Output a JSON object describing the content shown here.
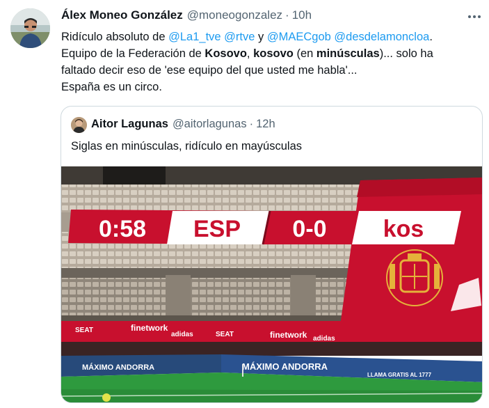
{
  "tweet": {
    "author_name": "Álex Moneo González",
    "author_handle": "@moneogonzalez",
    "separator": "·",
    "time": "10h",
    "text": {
      "l1_a": "Ridículo absoluto de ",
      "m1": "@La1_tve",
      "l1_b": " ",
      "m2": "@rtve",
      "l1_c": " y ",
      "m3": "@MAECgob",
      "l1_d": " ",
      "m4": "@desdelamoncloa",
      "l1_e": ".",
      "l2_a": "Equipo de la Federación de ",
      "l2_b1": "Kosovo",
      "l2_c": ", ",
      "l2_b2": "kosovo",
      "l2_d": " (en ",
      "l2_b3": "minúsculas",
      "l2_e": ")... solo ha",
      "l3": "faltado decir eso de 'ese equipo del que usted me habla'...",
      "l4": "España es un circo."
    },
    "more_icon": "more-horizontal-icon"
  },
  "quoted": {
    "author_name": "Aitor Lagunas",
    "author_handle": "@aitorlagunas",
    "separator": "·",
    "time": "12h",
    "text": "Siglas en minúsculas, ridículo en mayúsculas",
    "media": {
      "scoreboard": {
        "clock": "0:58",
        "home": "ESP",
        "score": "0-0",
        "away": "kos"
      },
      "boards": {
        "finetwork": "finetwork",
        "seat": "SEAT",
        "adidas": "adidas",
        "andorra": "MÁXIMO ANDORRA",
        "andorra2": "MÁXIMO ANDORRA",
        "small": "LLAMA GRATIS AL 1777"
      },
      "colors": {
        "red": "#c8102e",
        "pitch": "#2e9a3e",
        "seats": "#c9bfb2"
      }
    }
  }
}
